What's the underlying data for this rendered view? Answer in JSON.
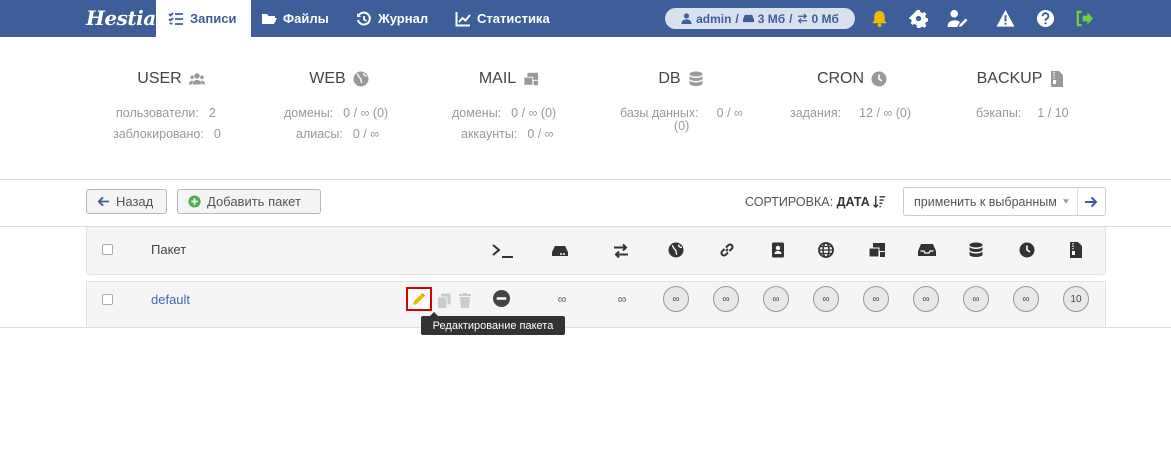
{
  "app": {
    "logo": "Hestia"
  },
  "nav": [
    {
      "label": "Записи",
      "icon": "list-check-icon",
      "active": true
    },
    {
      "label": "Файлы",
      "icon": "folder-open-icon"
    },
    {
      "label": "Журнал",
      "icon": "history-icon"
    },
    {
      "label": "Статистика",
      "icon": "chart-line-icon"
    }
  ],
  "user": {
    "name": "admin",
    "disk": "3 Мб",
    "bandwidth": "0 Мб",
    "sep1": "/",
    "sep2": "/"
  },
  "stats": [
    {
      "title": "USER",
      "icon": "users-icon",
      "rows": [
        {
          "label": "пользователи:",
          "value": "2"
        },
        {
          "label": "заблокировано:",
          "value": "0"
        }
      ]
    },
    {
      "title": "WEB",
      "icon": "globe-icon",
      "rows": [
        {
          "label": "домены:",
          "value": "0 / ∞ (0)"
        },
        {
          "label": "алиасы:",
          "value": "0 / ∞"
        }
      ]
    },
    {
      "title": "MAIL",
      "icon": "mail-bulk-icon",
      "rows": [
        {
          "label": "домены:",
          "value": "0 / ∞ (0)"
        },
        {
          "label": "аккаунты:",
          "value": "0 / ∞"
        }
      ]
    },
    {
      "title": "DB",
      "icon": "database-icon",
      "rows": [
        {
          "label": "базы данных:",
          "value": "0 / ∞"
        },
        {
          "label": "",
          "value": "(0)"
        }
      ]
    },
    {
      "title": "CRON",
      "icon": "clock-icon",
      "rows": [
        {
          "label": "задания:",
          "value": "12 / ∞ (0)"
        }
      ]
    },
    {
      "title": "BACKUP",
      "icon": "file-archive-icon",
      "rows": [
        {
          "label": "бэкапы:",
          "value": "1 / 10"
        }
      ]
    }
  ],
  "toolbar": {
    "back_label": "Назад",
    "add_label": "Добавить пакет",
    "sort_prefix": "СОРТИРОВКА:",
    "sort_value": "ДАТА",
    "bulk_label": "применить к выбранным"
  },
  "table": {
    "col_package": "Пакет",
    "rows": [
      {
        "name": "default",
        "bandwidth": "∞",
        "traffic": "∞",
        "limits": [
          "∞",
          "∞",
          "∞",
          "∞",
          "∞",
          "∞",
          "∞",
          "∞",
          "10"
        ]
      }
    ]
  },
  "tooltip": "Редактирование пакета",
  "colors": {
    "topbar": "#3d5e98",
    "accent_yellow": "#f5b800",
    "accent_green": "#4caf50",
    "highlight_red": "#d90000"
  }
}
